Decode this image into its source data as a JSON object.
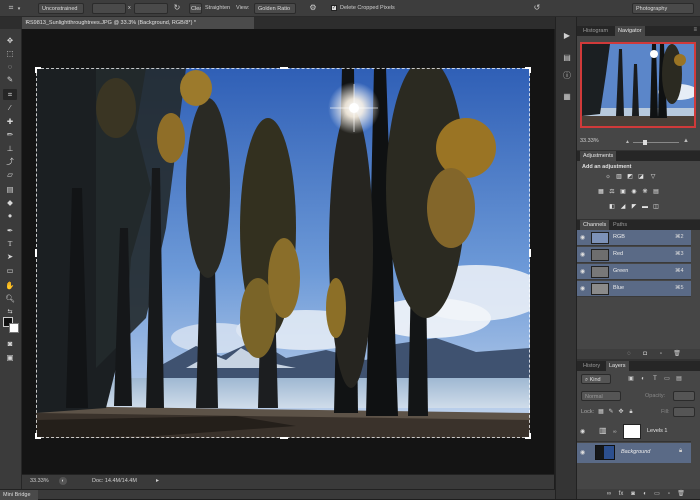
{
  "options_bar": {
    "ratio_select": "Unconstrained",
    "x_separator": "x",
    "clear_label": "Clear",
    "straighten_label": "Straighten",
    "view_label": "View:",
    "view_select": "Golden Ratio",
    "delete_cropped_label": "Delete Cropped Pixels",
    "delete_cropped_checked": true,
    "workspace_select": "Photography"
  },
  "document_tab": {
    "title": "RS9813_Sunlightthroughtrees.JPG @ 33.3% (Background, RGB/8*) *",
    "close": "×"
  },
  "status_bar": {
    "zoom": "33.33%",
    "doc_info": "Doc: 14.4M/14.4M"
  },
  "mini_bridge": {
    "label": "Mini Bridge"
  },
  "navigator_panel": {
    "tabs": [
      "Histogram",
      "Navigator"
    ],
    "zoom": "33.33%"
  },
  "adjustments_panel": {
    "title": "Adjustments",
    "prompt": "Add an adjustment"
  },
  "channels_panel": {
    "tabs": [
      "Channels",
      "Paths"
    ],
    "channels": [
      {
        "name": "RGB",
        "shortcut": "⌘2"
      },
      {
        "name": "Red",
        "shortcut": "⌘3"
      },
      {
        "name": "Green",
        "shortcut": "⌘4"
      },
      {
        "name": "Blue",
        "shortcut": "⌘5"
      }
    ]
  },
  "layers_panel": {
    "tabs": [
      "History",
      "Layers"
    ],
    "kind_filter": "Kind",
    "blend_mode": "Normal",
    "opacity_label": "Opacity:",
    "lock_label": "Lock:",
    "fill_label": "Fill:",
    "layers": [
      {
        "name": "Levels 1"
      },
      {
        "name": "Background"
      }
    ]
  },
  "colors": {
    "sky": "#4f7fcf",
    "accent_red": "#d03a3a",
    "channel_highlight": "#5a6a86"
  }
}
